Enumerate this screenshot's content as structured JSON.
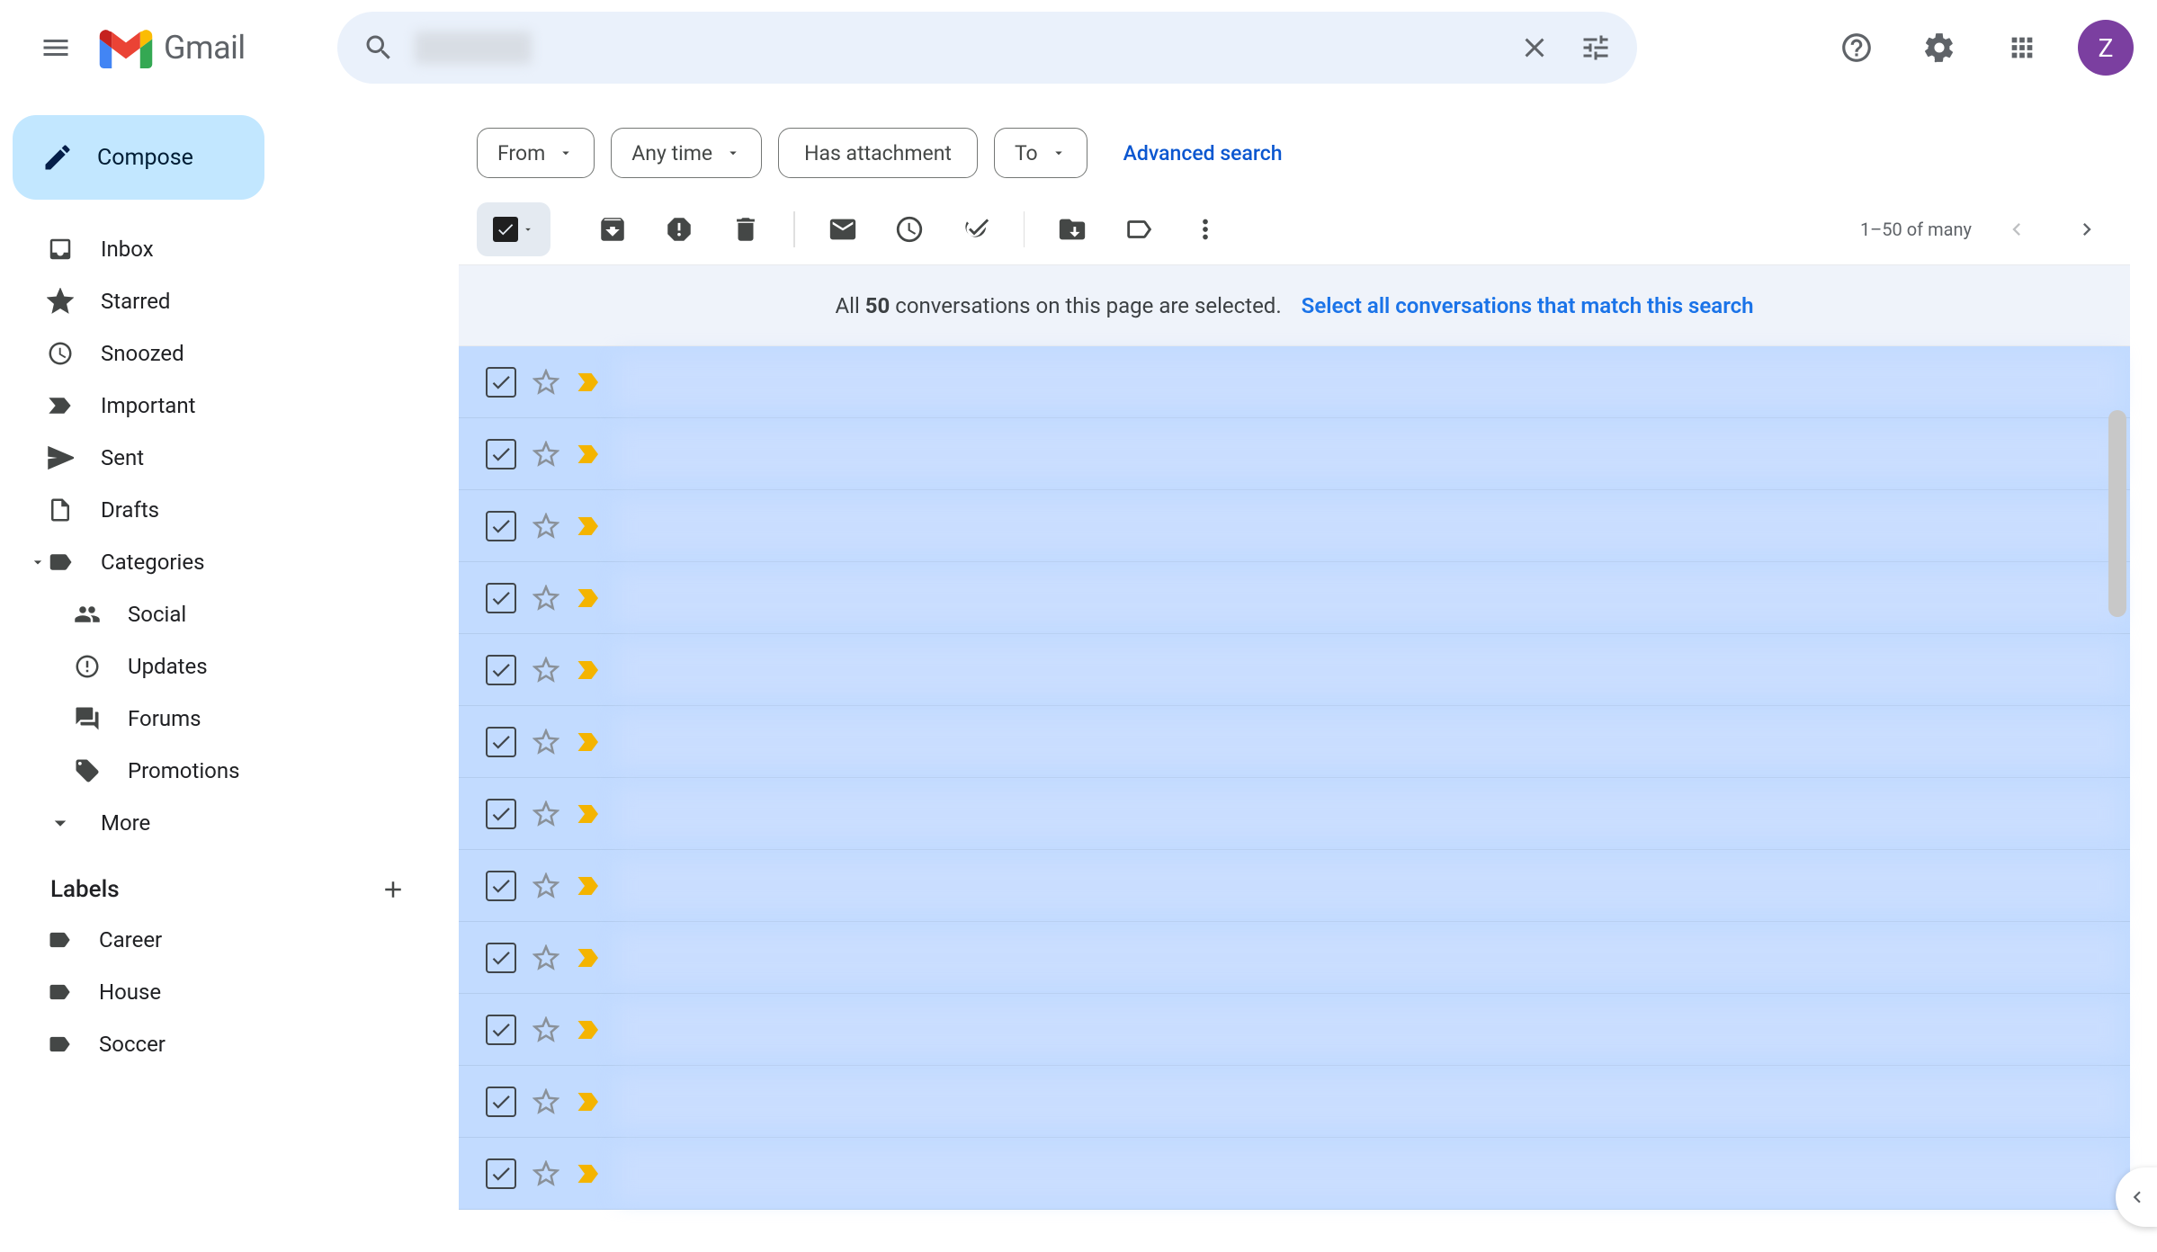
{
  "header": {
    "app_name": "Gmail",
    "search_placeholder": "Search mail",
    "avatar_initial": "Z"
  },
  "compose_label": "Compose",
  "nav": {
    "inbox": "Inbox",
    "starred": "Starred",
    "snoozed": "Snoozed",
    "important": "Important",
    "sent": "Sent",
    "drafts": "Drafts",
    "categories": "Categories",
    "social": "Social",
    "updates": "Updates",
    "forums": "Forums",
    "promotions": "Promotions",
    "more": "More"
  },
  "labels_header": "Labels",
  "labels": [
    "Career",
    "House",
    "Soccer"
  ],
  "chips": {
    "from": "From",
    "any_time": "Any time",
    "has_attachment": "Has attachment",
    "to": "To",
    "advanced": "Advanced search"
  },
  "pager_text": "1–50 of many",
  "selection_banner": {
    "prefix": "All ",
    "count": "50",
    "suffix": " conversations on this page are selected.",
    "link": "Select all conversations that match this search"
  },
  "row_count": 12
}
